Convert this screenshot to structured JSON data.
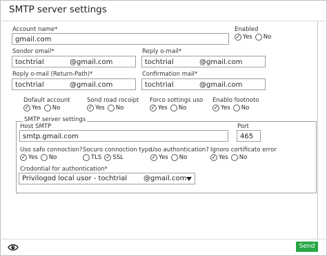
{
  "dialog": {
    "title": "SMTP server settings"
  },
  "account": {
    "label": "Account name*",
    "value": "gmail.com"
  },
  "enabled": {
    "label": "Enabled",
    "options": [
      "Yes",
      "No"
    ],
    "selected": "Yes"
  },
  "sender_email": {
    "label": "Sondor omail*",
    "local": "tochtrial",
    "domain": "@gmail.com"
  },
  "reply_email": {
    "label": "Reply o-mail*",
    "local": "tochtrial",
    "domain": "@gmail.com"
  },
  "reply_return": {
    "label": "Roply o-mail (Return-Path)*",
    "local": "tochtrial",
    "domain": "@gmail.com"
  },
  "confirmation_mail": {
    "label": "Confirmation mail*",
    "local": "tochtrial",
    "domain": "@gmail.com"
  },
  "default_account": {
    "label": "Dofault account",
    "options": [
      "Yes",
      "No"
    ],
    "selected": "Yes"
  },
  "send_read_receipt": {
    "label": "Sond road rocoipt",
    "options": [
      "Yes",
      "No"
    ],
    "selected": "Yes"
  },
  "force_settings": {
    "label": "Forco sottings uso",
    "options": [
      "Yes",
      "No"
    ],
    "selected": "Yes"
  },
  "enable_footnote": {
    "label": "Enablo footnoto",
    "options": [
      "Yes",
      "No"
    ],
    "selected": "Yes"
  },
  "smtp_group": {
    "legend": "SMTP server settings",
    "host": {
      "label": "Host SMTP",
      "value": "smtp.gmail.com"
    },
    "port": {
      "label": "Port",
      "value": "465"
    },
    "safe_connection": {
      "label": "Uso safo connoction?",
      "options": [
        "Yes",
        "No"
      ],
      "selected": "Yes"
    },
    "secure_type": {
      "label": "Socuro connoction typo",
      "options": [
        "TLS",
        "SSL"
      ],
      "selected": "SSL"
    },
    "use_auth": {
      "label": "Uso authontication?",
      "options": [
        "Yes",
        "No"
      ],
      "selected": "Yes"
    },
    "ignore_cert": {
      "label": "Ignoro cortificato error",
      "options": [
        "Yes",
        "No"
      ],
      "selected": "Yes"
    },
    "credential": {
      "label": "Crodontial for authontication*",
      "value": "Privilogod local usor - tochtrial",
      "domain": "@gmail.com"
    }
  },
  "footer": {
    "send_label": "Send",
    "eye_icon": "eye-icon",
    "accent": "#27a745"
  }
}
